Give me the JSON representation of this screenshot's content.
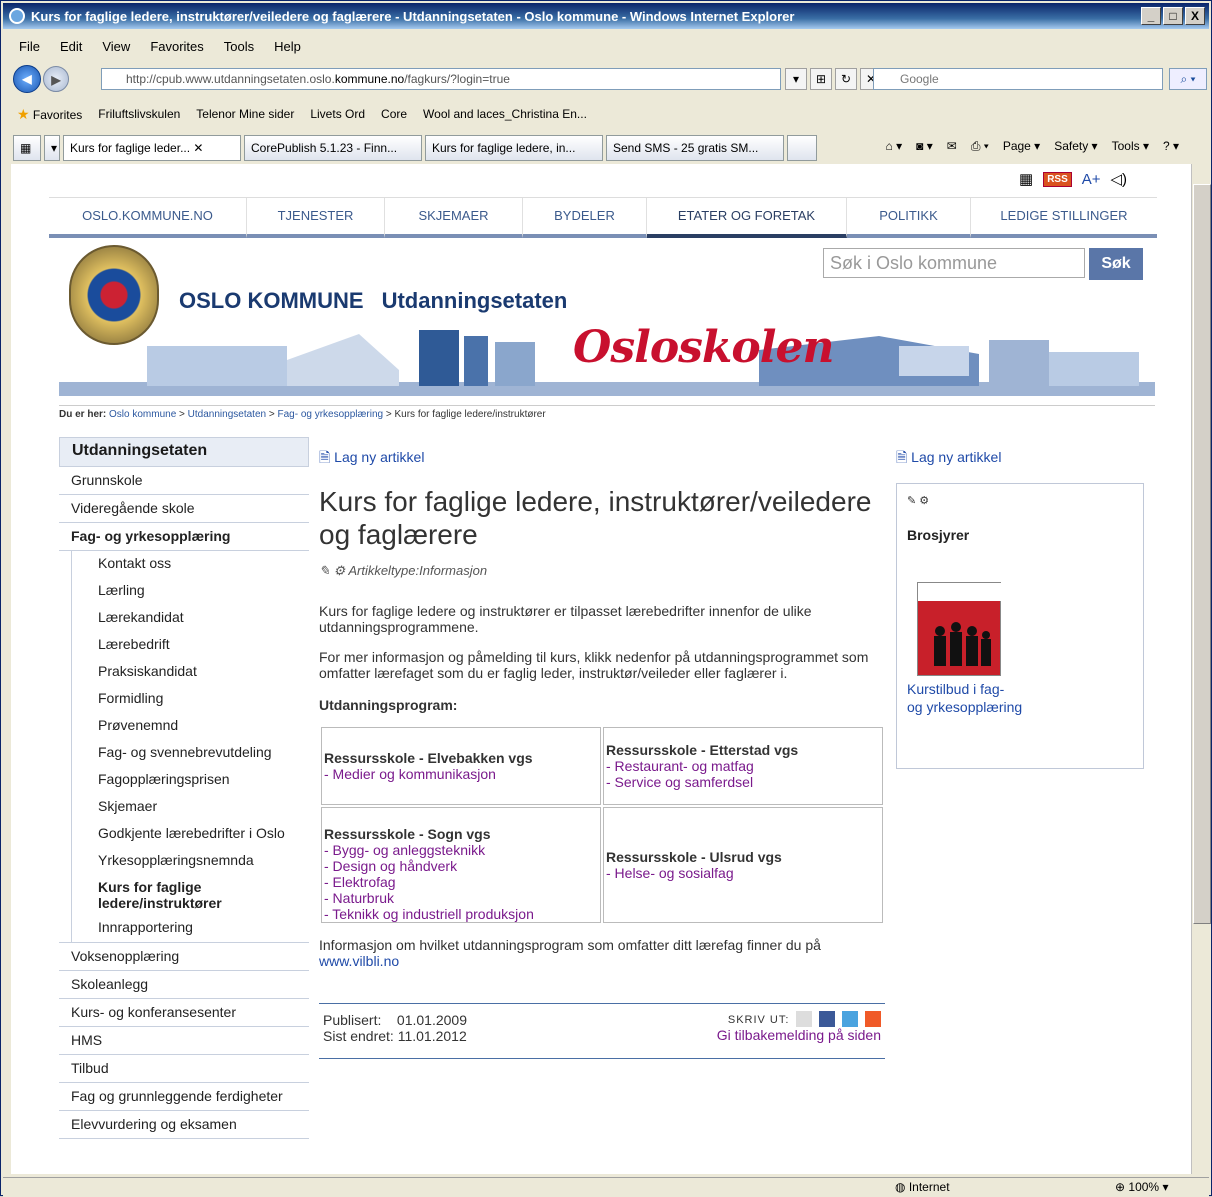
{
  "window": {
    "title": "Kurs for faglige ledere, instruktører/veiledere og faglærere - Utdanningsetaten - Oslo kommune - Windows Internet Explorer",
    "buttons": [
      "_",
      "□",
      "X"
    ]
  },
  "menubar": [
    "File",
    "Edit",
    "View",
    "Favorites",
    "Tools",
    "Help"
  ],
  "address": {
    "url_prefix": "http://cpub.www.utdanningsetaten.oslo.",
    "url_domain": "kommune.no",
    "url_suffix": "/fagkurs/?login=true",
    "search_placeholder": "Google"
  },
  "favorites": {
    "label": "Favorites",
    "items": [
      "Friluftslivskulen",
      "Telenor Mine sider",
      "Livets Ord",
      "Core",
      "Wool and laces_Christina En..."
    ]
  },
  "tabs": [
    "Kurs for faglige leder...",
    "CorePublish 5.1.23 - Finn...",
    "Kurs for faglige ledere, in...",
    "Send SMS - 25 gratis SM..."
  ],
  "tab_tools": [
    "Page ▾",
    "Safety ▾",
    "Tools ▾"
  ],
  "status": {
    "zone": "Internet",
    "zoom": "100%"
  },
  "site": {
    "top_tools": {
      "rss": "RSS",
      "font": "A+"
    },
    "nav": [
      "OSLO.KOMMUNE.NO",
      "TJENESTER",
      "SKJEMAER",
      "BYDELER",
      "ETATER OG FORETAK",
      "POLITIKK",
      "LEDIGE STILLINGER"
    ],
    "brand_main": "OSLO KOMMUNE",
    "brand_sub": "Utdanningsetaten",
    "banner_text": "Osloskolen",
    "search_placeholder": "Søk i Oslo kommune",
    "search_button": "Søk",
    "breadcrumb": {
      "label": "Du er her:",
      "items": [
        "Oslo kommune",
        "Utdanningsetaten",
        "Fag- og yrkesopplæring"
      ],
      "current": "Kurs for faglige ledere/instruktører"
    }
  },
  "sidebar": {
    "heading": "Utdanningsetaten",
    "items_top": [
      "Grunnskole",
      "Videregående skole"
    ],
    "active": "Fag- og yrkesopplæring",
    "sub": [
      "Kontakt oss",
      "Lærling",
      "Lærekandidat",
      "Lærebedrift",
      "Praksiskandidat",
      "Formidling",
      "Prøvenemnd",
      "Fag- og svennebrevutdeling",
      "Fagopplæringsprisen",
      "Skjemaer",
      "Godkjente lærebedrifter i Oslo",
      "Yrkesopplæringsnemnda"
    ],
    "sub_active": "Kurs for faglige ledere/instruktører",
    "sub_last": "Innrapportering",
    "items_bottom": [
      "Voksenopplæring",
      "Skoleanlegg",
      "Kurs- og konferansesenter",
      "HMS",
      "Tilbud",
      "Fag og grunnleggende ferdigheter",
      "Elevvurdering og eksamen"
    ]
  },
  "article": {
    "new_link": "Lag ny artikkel",
    "title": "Kurs for faglige ledere, instruktører/veiledere og faglærere",
    "type": "Artikkeltype:Informasjon",
    "p1": "Kurs for faglige ledere og instruktører er tilpasset lærebedrifter innenfor de ulike utdanningsprogrammene.",
    "p2": "For mer informasjon og påmelding til kurs, klikk nedenfor på utdanningsprogrammet som omfatter lærefaget som du er faglig leder, instruktør/veileder eller faglærer i.",
    "section": "Utdanningsprogram:",
    "schools": [
      {
        "name": "Ressursskole - Elvebakken vgs",
        "programs": [
          "- Medier og kommunikasjon"
        ]
      },
      {
        "name": "Ressursskole - Etterstad vgs",
        "programs": [
          "- Restaurant- og matfag",
          "- Service og samferdsel"
        ]
      },
      {
        "name": "Ressursskole - Sogn vgs",
        "programs": [
          "- Bygg- og anleggsteknikk",
          "- Design og håndverk",
          "- Elektrofag",
          "- Naturbruk",
          "- Teknikk og industriell produksjon"
        ]
      },
      {
        "name": "Ressursskole - Ulsrud vgs",
        "programs": [
          "- Helse- og sosialfag"
        ]
      }
    ],
    "info_text": "Informasjon om hvilket utdanningsprogram som omfatter ditt lærefag finner du på",
    "info_link": "www.vilbli.no",
    "published_label": "Publisert:",
    "published": "01.01.2009",
    "changed_label": "Sist endret:",
    "changed": "11.01.2012",
    "write_out": "SKRIV UT:",
    "feedback": "Gi tilbakemelding på siden"
  },
  "right": {
    "new_link": "Lag ny artikkel",
    "box_title": "Brosjyrer",
    "box_link_1": "Kurstilbud i fag-",
    "box_link_2": "og yrkesopplæring"
  }
}
